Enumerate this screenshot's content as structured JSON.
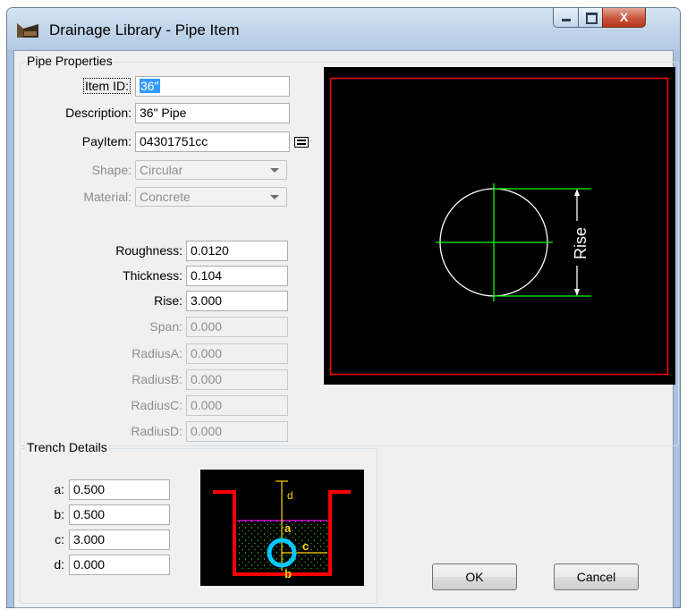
{
  "window": {
    "title": "Drainage Library - Pipe Item",
    "min_icon": "minimize-icon",
    "max_icon": "maximize-icon",
    "close_icon": "close-icon",
    "close_glyph": "X"
  },
  "pipe_properties": {
    "legend": "Pipe Properties",
    "item_id": {
      "label": "Item ID:",
      "value": "36\""
    },
    "description": {
      "label": "Description:",
      "value": "36\" Pipe"
    },
    "payitem": {
      "label": "PayItem:",
      "value": "04301751cc"
    },
    "shape": {
      "label": "Shape:",
      "value": "Circular"
    },
    "material": {
      "label": "Material:",
      "value": "Concrete"
    },
    "roughness": {
      "label": "Roughness:",
      "value": "0.0120"
    },
    "thickness": {
      "label": "Thickness:",
      "value": "0.104"
    },
    "rise": {
      "label": "Rise:",
      "value": "3.000"
    },
    "span": {
      "label": "Span:",
      "value": "0.000"
    },
    "radius_a": {
      "label": "RadiusA:",
      "value": "0.000"
    },
    "radius_b": {
      "label": "RadiusB:",
      "value": "0.000"
    },
    "radius_c": {
      "label": "RadiusC:",
      "value": "0.000"
    },
    "radius_d": {
      "label": "RadiusD:",
      "value": "0.000"
    }
  },
  "preview": {
    "rise_label": "Rise",
    "colors": {
      "border": "#ff0000",
      "pipe": "#ffffff",
      "axes": "#00ff00"
    }
  },
  "trench_details": {
    "legend": "Trench Details",
    "a": {
      "label": "a:",
      "value": "0.500"
    },
    "b": {
      "label": "b:",
      "value": "0.500"
    },
    "c": {
      "label": "c:",
      "value": "3.000"
    },
    "d": {
      "label": "d:",
      "value": "0.000"
    },
    "diagram_labels": {
      "a": "a",
      "b": "b",
      "c": "c",
      "d": "d"
    },
    "colors": {
      "trench": "#ff0000",
      "pipe": "#00c8ff",
      "dims": "#ffd800",
      "cover": "#ff00ff"
    }
  },
  "buttons": {
    "ok": "OK",
    "cancel": "Cancel"
  }
}
